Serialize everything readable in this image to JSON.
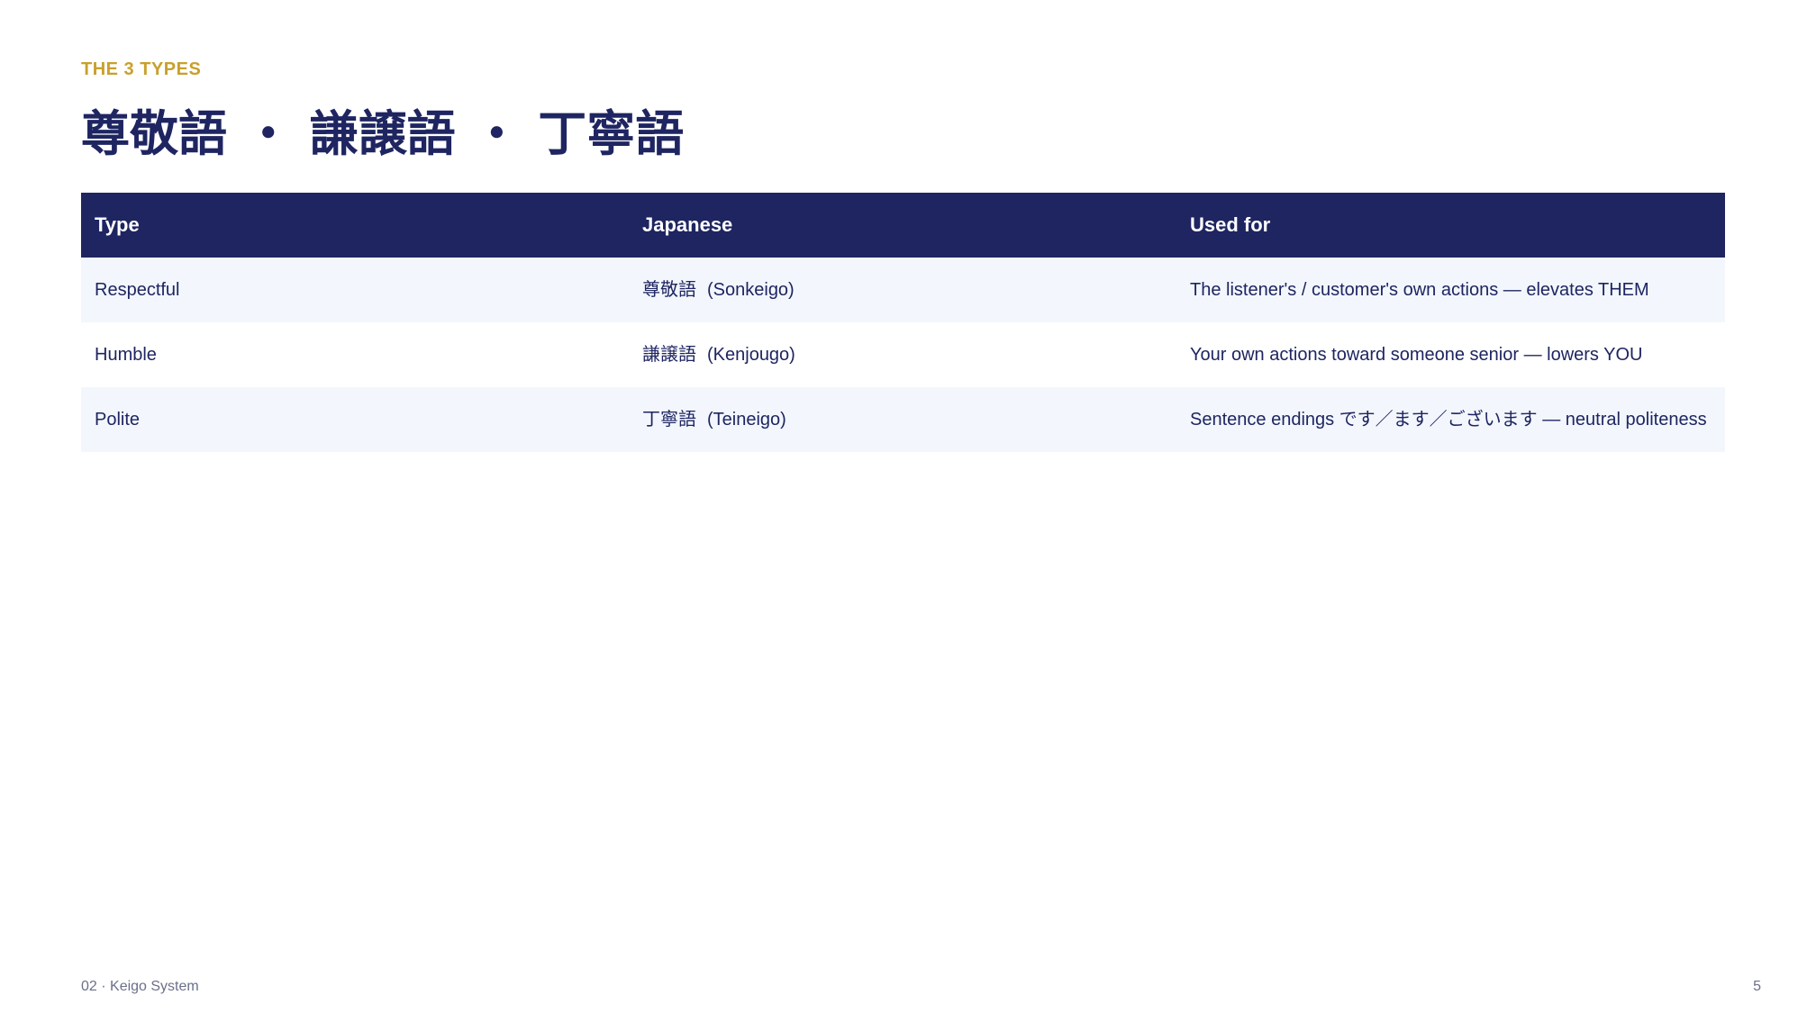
{
  "slide": {
    "kicker": "THE 3 TYPES",
    "title": "尊敬語 ・ 謙譲語 ・ 丁寧語"
  },
  "table": {
    "headers": [
      "Type",
      "Japanese",
      "Used for"
    ],
    "rows": [
      {
        "type": "Respectful",
        "japanese": "尊敬語",
        "romaji": "(Sonkeigo)",
        "used_for": "The listener's / customer's own actions — elevates THEM"
      },
      {
        "type": "Humble",
        "japanese": "謙譲語",
        "romaji": "(Kenjougo)",
        "used_for": "Your own actions toward someone senior — lowers YOU"
      },
      {
        "type": "Polite",
        "japanese": "丁寧語",
        "romaji": "(Teineigo)",
        "used_for": "Sentence endings  です／ます／ございます —  neutral politeness"
      }
    ]
  },
  "footer": {
    "section": "02 · Keigo System",
    "page_number": "5"
  },
  "colors": {
    "navy": "#1e2561",
    "gold": "#c9a02d",
    "row_alt": "#f3f7fd"
  }
}
